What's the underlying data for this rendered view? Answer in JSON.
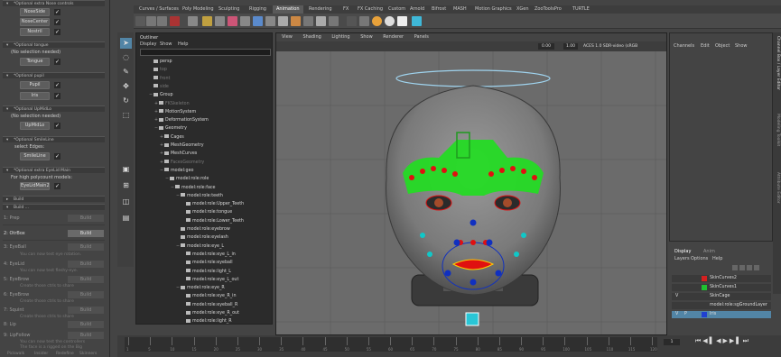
{
  "left_panel": {
    "sections": [
      {
        "header": "*Optional extra Nose controls"
      },
      {
        "header": "*Optional tongue"
      },
      {
        "header": "*Optional pupil"
      },
      {
        "header": "*Optional UpMidLo"
      },
      {
        "header": "*Optional SmileLine"
      },
      {
        "header": "*Optional extra EyeLid Main"
      }
    ],
    "nose_buttons": [
      "NoseSide",
      "NoseCenter",
      "Nostril"
    ],
    "tongue_text": "(No selection needed)",
    "tongue_button": "Tongue",
    "pupil_buttons": [
      "Pupil",
      "Iris"
    ],
    "upmidlo_text": "(No selection needed)",
    "upmidlo_button": "UpMidLo",
    "smileline_text": "select Edges:",
    "smileline_button": "SmileLine",
    "eyelid_text": "For high polycount models:",
    "eyelid_button": "EyeLidMain2",
    "build_headers": [
      "Build",
      "Build ..."
    ],
    "steps": [
      {
        "num": "1: Prep",
        "btn": "Build"
      },
      {
        "num": "2: OtrBox",
        "btn": "Build"
      },
      {
        "num": "3: EyeBall",
        "btn": "Build",
        "sub": "You can now test eye rotation."
      },
      {
        "num": "4: EyeLid",
        "btn": "Build",
        "sub": "You can now test fleshy-eye."
      },
      {
        "num": "5: EyeBrow",
        "btn": "Build",
        "sub": "Create those ctrls to share"
      },
      {
        "num": "6: EyeBrow",
        "btn": "Build",
        "sub": "Create those ctrls to share"
      },
      {
        "num": "7: Squint",
        "btn": "Build",
        "sub": "Create those ctrls to share"
      },
      {
        "num": "8: Lip",
        "btn": "Build"
      },
      {
        "num": "9: LipFollow",
        "btn": "Build",
        "sub": "You can now test the controllers"
      },
      {
        "num": "",
        "sub": "The face is a rigged on the Big"
      }
    ],
    "footer": [
      "Pickwalk",
      "Insider",
      "Redefine",
      "Skinners"
    ]
  },
  "shelf": {
    "tabs": [
      "Curves / Surfaces",
      "Poly Modeling",
      "Sculpting",
      "Rigging",
      "Animation",
      "Rendering",
      "FX",
      "FX Caching",
      "Custom",
      "Arnold",
      "Bifrost",
      "MASH",
      "Motion Graphics",
      "XGen",
      "ZooToolsPro",
      "TURTLE"
    ],
    "active_tab": "Animation"
  },
  "outliner": {
    "title": "Outliner",
    "menu": [
      "Display",
      "Show",
      "Help"
    ],
    "rows": [
      {
        "label": "persp",
        "indent": 0,
        "dim": false,
        "exp": ""
      },
      {
        "label": "top",
        "indent": 0,
        "dim": true,
        "exp": ""
      },
      {
        "label": "front",
        "indent": 0,
        "dim": true,
        "exp": ""
      },
      {
        "label": "side",
        "indent": 0,
        "dim": true,
        "exp": ""
      },
      {
        "label": "Group",
        "indent": 0,
        "dim": false,
        "exp": "−"
      },
      {
        "label": "FKSkeleton",
        "indent": 1,
        "dim": true,
        "exp": "+"
      },
      {
        "label": "MotionSystem",
        "indent": 1,
        "dim": false,
        "exp": "+"
      },
      {
        "label": "DeformationSystem",
        "indent": 1,
        "dim": false,
        "exp": "+"
      },
      {
        "label": "Geometry",
        "indent": 1,
        "dim": false,
        "exp": "−"
      },
      {
        "label": "Cages",
        "indent": 2,
        "dim": false,
        "exp": "+"
      },
      {
        "label": "MeshGeometry",
        "indent": 2,
        "dim": false,
        "exp": "+"
      },
      {
        "label": "MeshCurves",
        "indent": 2,
        "dim": false,
        "exp": "+"
      },
      {
        "label": "FacesGeometry",
        "indent": 2,
        "dim": true,
        "exp": "+"
      },
      {
        "label": "model:geo",
        "indent": 2,
        "dim": false,
        "exp": "−"
      },
      {
        "label": "model:role:role",
        "indent": 3,
        "dim": false,
        "exp": "−"
      },
      {
        "label": "model:role:face",
        "indent": 4,
        "dim": false,
        "exp": "−"
      },
      {
        "label": "model:role:teeth",
        "indent": 5,
        "dim": false,
        "exp": "−"
      },
      {
        "label": "model:role:Upper_Teeth",
        "indent": 6,
        "dim": false,
        "exp": ""
      },
      {
        "label": "model:role:tongue",
        "indent": 6,
        "dim": false,
        "exp": ""
      },
      {
        "label": "model:role:Lower_Teeth",
        "indent": 6,
        "dim": false,
        "exp": ""
      },
      {
        "label": "model:role:eyebrow",
        "indent": 5,
        "dim": false,
        "exp": ""
      },
      {
        "label": "model:role:eyelash",
        "indent": 5,
        "dim": false,
        "exp": ""
      },
      {
        "label": "model:role:eye_L",
        "indent": 5,
        "dim": false,
        "exp": "−"
      },
      {
        "label": "model:role:eye_L_in",
        "indent": 6,
        "dim": false,
        "exp": ""
      },
      {
        "label": "model:role:eyeball",
        "indent": 6,
        "dim": false,
        "exp": ""
      },
      {
        "label": "model:role:light_L",
        "indent": 6,
        "dim": false,
        "exp": ""
      },
      {
        "label": "model:role:eye_L_out",
        "indent": 6,
        "dim": false,
        "exp": ""
      },
      {
        "label": "model:role:eye_R",
        "indent": 5,
        "dim": false,
        "exp": "−"
      },
      {
        "label": "model:role:eye_R_in",
        "indent": 6,
        "dim": false,
        "exp": ""
      },
      {
        "label": "model:role:eyeball_R",
        "indent": 6,
        "dim": false,
        "exp": ""
      },
      {
        "label": "model:role:eye_R_out",
        "indent": 6,
        "dim": false,
        "exp": ""
      },
      {
        "label": "model:role:light_R",
        "indent": 6,
        "dim": false,
        "exp": ""
      }
    ]
  },
  "viewport": {
    "menu": [
      "View",
      "Shading",
      "Lighting",
      "Show",
      "Renderer",
      "Panels"
    ],
    "fields": [
      "0.00",
      "1.00"
    ],
    "colorspace": "ACES 1.0 SDR-video (sRGB"
  },
  "channel_box": {
    "menu": [
      "Channels",
      "Edit",
      "Object",
      "Show"
    ],
    "side_tabs": [
      "Channel Box / Layer Editor",
      "Modeling Toolkit",
      "Attribute Editor"
    ]
  },
  "layer_editor": {
    "tabs": [
      "Display",
      "Anim"
    ],
    "menu": [
      "Layers",
      "Options",
      "Help"
    ],
    "layers": [
      {
        "name": "SkinCurves2",
        "color": "#d42020",
        "v": "",
        "p": ""
      },
      {
        "name": "SkinCurves1",
        "color": "#20c030",
        "v": "",
        "p": ""
      },
      {
        "name": "SkinCage",
        "color": "#3a3a3a",
        "v": "V",
        "p": ""
      },
      {
        "name": "model:role:sgGroundLayer",
        "color": "#3a3a3a",
        "v": "",
        "p": ""
      },
      {
        "name": "Iris",
        "color": "#2040d0",
        "v": "V",
        "p": "P"
      }
    ]
  },
  "time_slider": {
    "ticks": [
      "1",
      "5",
      "10",
      "15",
      "20",
      "25",
      "30",
      "35",
      "40",
      "45",
      "50",
      "55",
      "60",
      "65",
      "70",
      "75",
      "80",
      "85",
      "90",
      "95",
      "100",
      "105",
      "110",
      "115",
      "120"
    ],
    "current_frame": "1"
  },
  "colors": {
    "accent": "#5285a6",
    "face_green": "#22dd22",
    "ctrl_red": "#e01010",
    "ctrl_blue": "#1030c0",
    "ctrl_cyan": "#10c8c8"
  }
}
